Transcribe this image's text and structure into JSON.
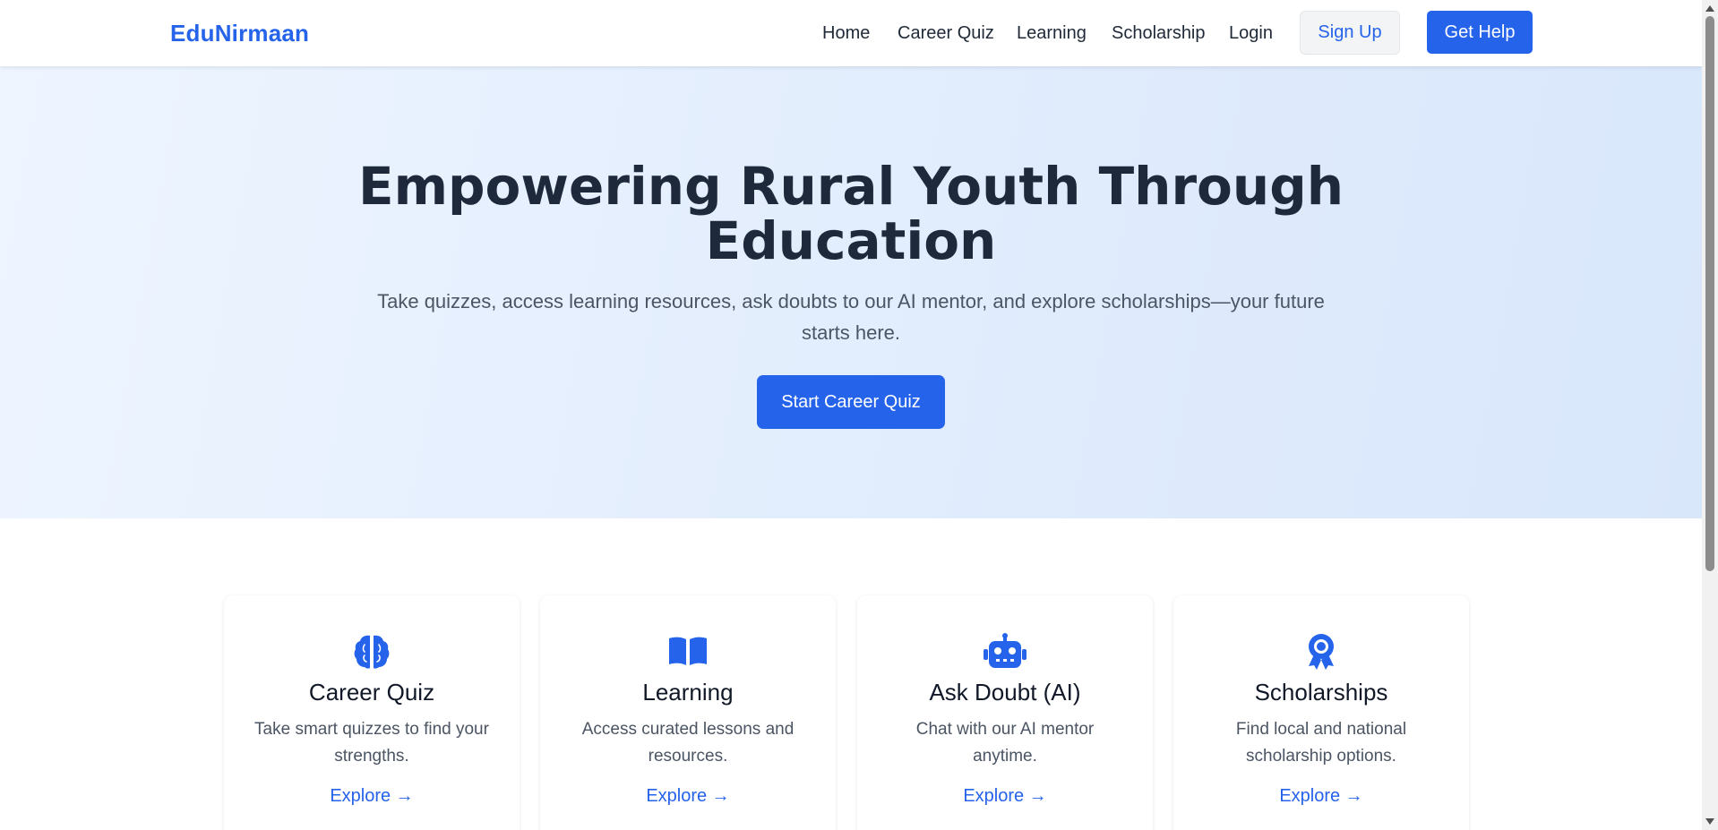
{
  "brand": {
    "name": "EduNirmaan"
  },
  "nav": {
    "links": [
      "Home",
      "Career Quiz",
      "Learning",
      "Scholarship",
      "Login"
    ],
    "signup_label": "Sign Up",
    "help_label": "Get Help"
  },
  "hero": {
    "title": "Empowering Rural Youth Through Education",
    "subtitle": "Take quizzes, access learning resources, ask doubts to our AI mentor, and explore scholarships—your future starts here.",
    "cta_label": "Start Career Quiz"
  },
  "features": [
    {
      "icon": "brain-icon",
      "title": "Career Quiz",
      "description": "Take smart quizzes to find your strengths.",
      "link": "Explore →"
    },
    {
      "icon": "book-icon",
      "title": "Learning",
      "description": "Access curated lessons and resources.",
      "link": "Explore →"
    },
    {
      "icon": "robot-icon",
      "title": "Ask Doubt (AI)",
      "description": "Chat with our AI mentor anytime.",
      "link": "Explore →"
    },
    {
      "icon": "award-icon",
      "title": "Scholarships",
      "description": "Find local and national scholarship options.",
      "link": "Explore →"
    }
  ],
  "colors": {
    "accent": "#2563eb",
    "heading": "#1e293b",
    "body_text": "#4b5563"
  }
}
